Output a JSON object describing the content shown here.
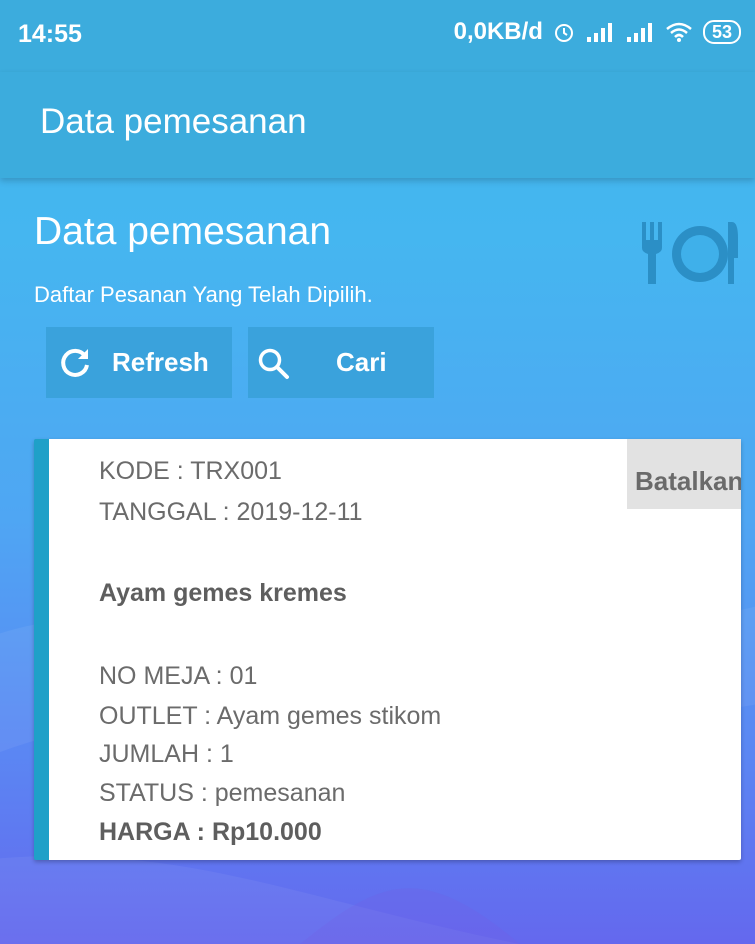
{
  "status_bar": {
    "time": "14:55",
    "network_speed": "0,0KB/d",
    "battery": "53"
  },
  "app_bar": {
    "title": "Data pemesanan"
  },
  "header": {
    "title": "Data pemesanan",
    "subtitle": "Daftar Pesanan Yang Telah Dipilih.",
    "icon": "restaurant-icon"
  },
  "buttons": {
    "refresh": {
      "label": "Refresh",
      "icon": "refresh-icon"
    },
    "search": {
      "label": "Cari",
      "icon": "search-icon"
    }
  },
  "order": {
    "kode": "KODE : TRX001",
    "tanggal": "TANGGAL : 2019-12-11",
    "menu": "Ayam gemes kremes",
    "no_meja": "NO MEJA :  01",
    "outlet": "OUTLET : Ayam gemes stikom",
    "jumlah": "JUMLAH : 1",
    "status": "STATUS : pemesanan",
    "harga": "HARGA : Rp10.000",
    "cancel_label": "Batalkan"
  },
  "colors": {
    "primary": "#3cacdd",
    "card_accent": "#1fa0c8",
    "button": "#3aa2dc"
  }
}
